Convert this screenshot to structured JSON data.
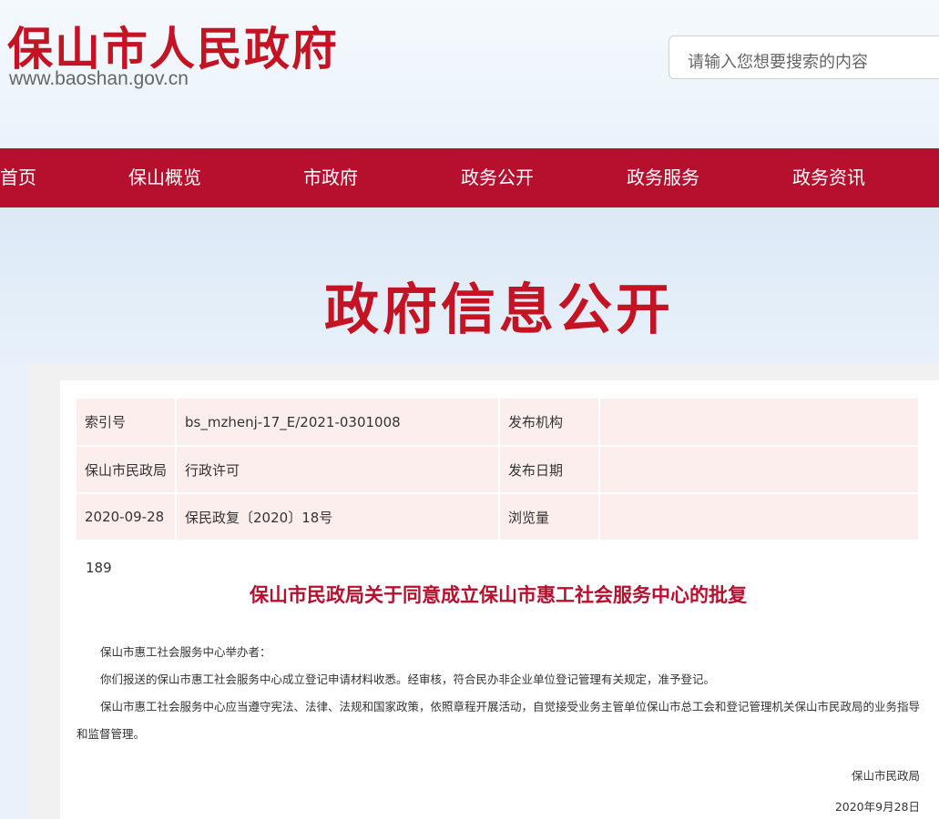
{
  "header": {
    "site_title": "保山市人民政府",
    "site_url": "www.baoshan.gov.cn",
    "search_placeholder": "请输入您想要搜索的内容"
  },
  "nav": {
    "items": [
      "首页",
      "保山概览",
      "市政府",
      "政务公开",
      "政务服务",
      "政务资讯"
    ]
  },
  "banner": {
    "title": "政府信息公开"
  },
  "meta": {
    "row1": [
      "索引号",
      "bs_mzhenj-17_E/2021-0301008",
      "发布机构"
    ],
    "row2": [
      "保山市民政局",
      "行政许可",
      "发布日期"
    ],
    "row3": [
      "2020-09-28",
      "保民政复〔2020〕18号",
      "浏览量"
    ],
    "views": "189"
  },
  "document": {
    "title": "保山市民政局关于同意成立保山市惠工社会服务中心的批复",
    "paragraphs": [
      "保山市惠工社会服务中心举办者：",
      "你们报送的保山市惠工社会服务中心成立登记申请材料收悉。经审核，符合民办非企业单位登记管理有关规定，准予登记。",
      "保山市惠工社会服务中心应当遵守宪法、法律、法规和国家政策，依照章程开展活动，自觉接受业务主管单位保山市总工会和登记管理机关保山市民政局的业务指导和监督管理。"
    ],
    "signature": "保山市民政局",
    "date": "2020年9月28日"
  },
  "colors": {
    "brand_red": "#b7102f",
    "title_red": "#c41424",
    "meta_bg": "#fdeeee"
  }
}
